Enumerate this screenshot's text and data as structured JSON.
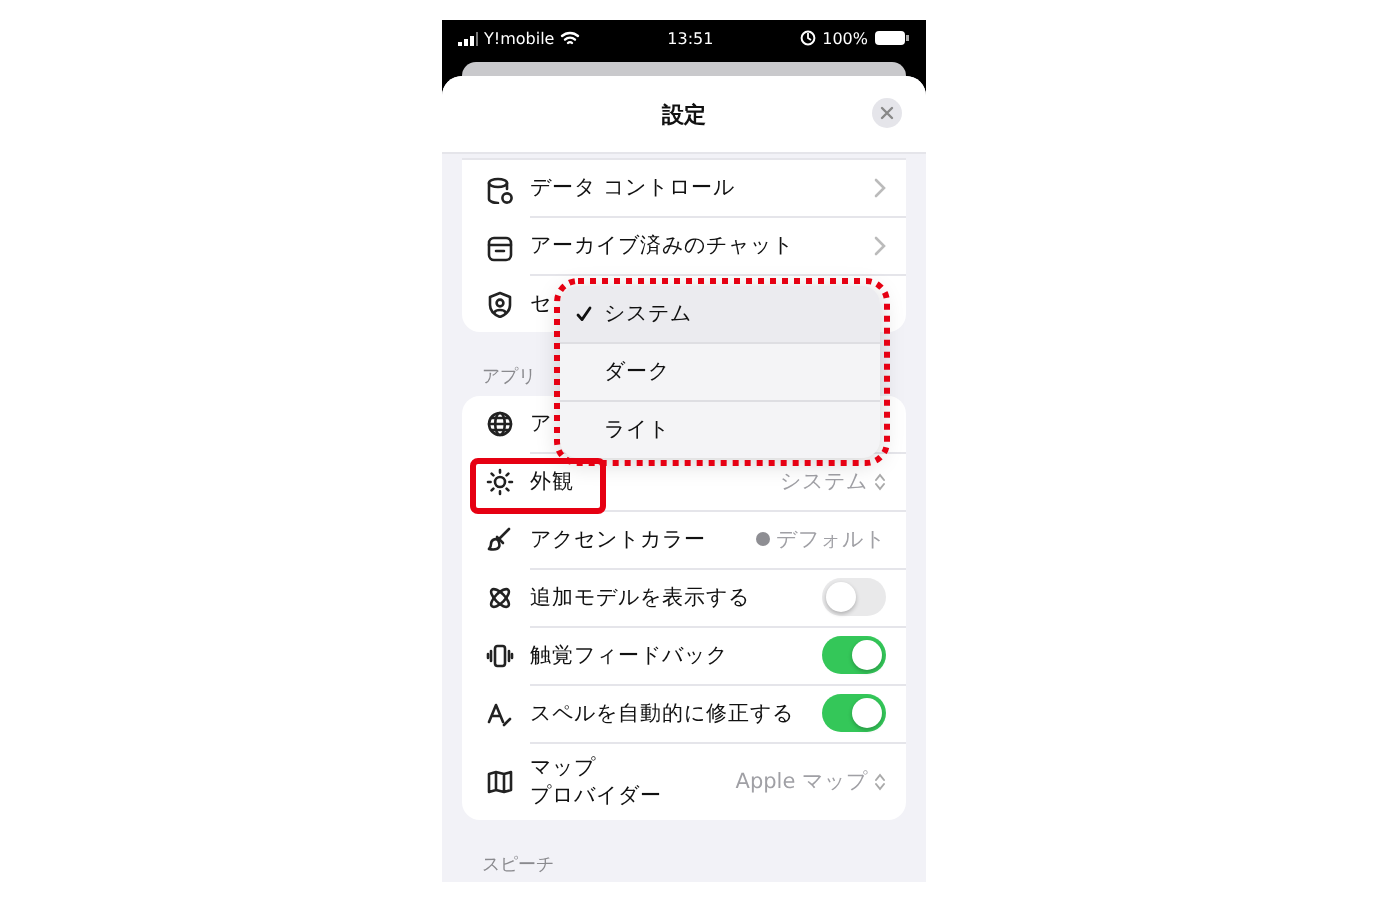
{
  "status_bar": {
    "carrier": "Y!mobile",
    "time": "13:51",
    "battery": "100%"
  },
  "sheet": {
    "title": "設定"
  },
  "sections": [
    {
      "items": [
        {
          "kind": "link",
          "label": "データ コントロール"
        },
        {
          "kind": "link",
          "label": "アーカイブ済みのチャット"
        },
        {
          "kind": "plain",
          "label": "セ"
        }
      ]
    },
    {
      "label": "アプリ",
      "items": [
        {
          "kind": "plain",
          "label": "ア"
        },
        {
          "kind": "value",
          "label": "外観",
          "value": "システム"
        },
        {
          "kind": "color",
          "label": "アクセントカラー",
          "value": "デフォルト",
          "color": "#8e8e93"
        },
        {
          "kind": "toggle",
          "label": "追加モデルを表示する",
          "on": false
        },
        {
          "kind": "toggle",
          "label": "触覚フィードバック",
          "on": true
        },
        {
          "kind": "toggle",
          "label": "スペルを自動的に修正する",
          "on": true
        },
        {
          "kind": "value",
          "label_lines": [
            "マップ",
            "プロバイダー"
          ],
          "value": "Apple マップ"
        }
      ]
    },
    {
      "label": "スピーチ"
    }
  ],
  "menu": {
    "options": [
      {
        "label": "システム",
        "selected": true
      },
      {
        "label": "ダーク",
        "selected": false
      },
      {
        "label": "ライト",
        "selected": false
      }
    ]
  }
}
